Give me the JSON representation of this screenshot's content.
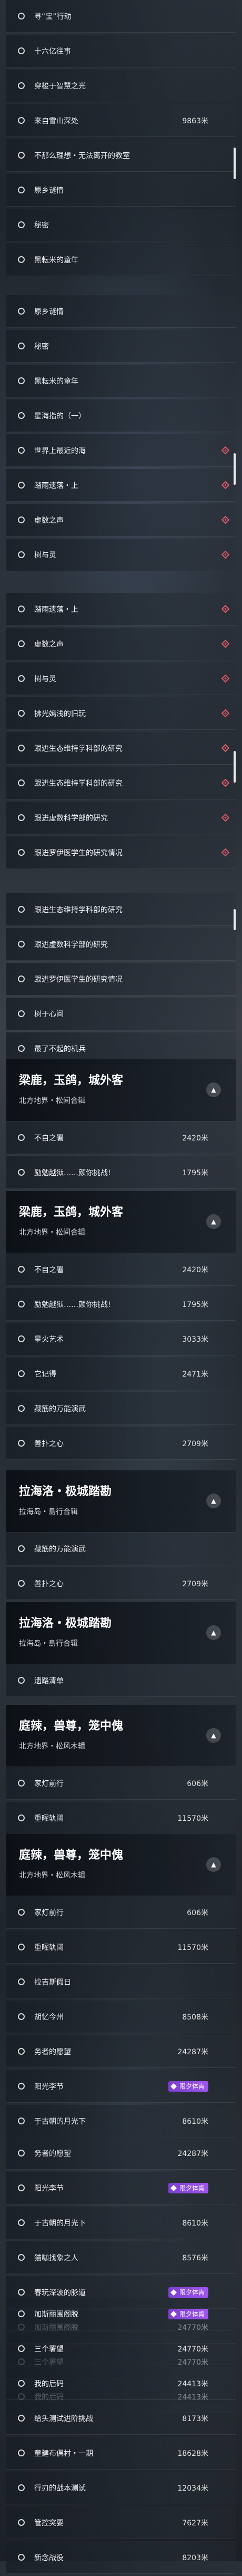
{
  "quests": {
    "g1": [
      {
        "label": "寻“宝”行动"
      },
      {
        "label": "十六亿往事"
      },
      {
        "label": "穿梭于智慧之光"
      },
      {
        "label": "来自雪山深处",
        "dist": "9863米"
      },
      {
        "label": "不那么理想・无法离开的教室"
      },
      {
        "label": "原乡谜情"
      },
      {
        "label": "秘密"
      },
      {
        "label": "黑耘米的童年"
      }
    ],
    "g2": [
      {
        "label": "原乡谜情"
      },
      {
        "label": "秘密"
      },
      {
        "label": "黑耘米的童年"
      },
      {
        "label": "星海指的（一）"
      },
      {
        "label": "世界上最近的海"
      },
      {
        "label": "踏雨遗落・上"
      },
      {
        "label": "虚数之声"
      },
      {
        "label": "树与灵"
      }
    ],
    "g3": [
      {
        "label": "踏雨遗落・上"
      },
      {
        "label": "虚数之声"
      },
      {
        "label": "树与灵"
      },
      {
        "label": "拂光嫣浅的旧玩"
      },
      {
        "label": "跟进生态维持学科部的研究"
      },
      {
        "label": "跟进生态维持学科部的研究"
      },
      {
        "label": "跟进虚数科学部的研究"
      },
      {
        "label": "跟进罗伊医学生的研究情况"
      }
    ],
    "g4": [
      {
        "label": "跟进生态维持学科部的研究"
      },
      {
        "label": "跟进虚数科学部的研究"
      },
      {
        "label": "跟进罗伊医学生的研究情况"
      },
      {
        "label": "树于心间"
      },
      {
        "label": "最了不起的机兵"
      }
    ],
    "sec1": {
      "title": "梁鹿，玉鸽，城外客",
      "sub": "北方地界・松间合辑",
      "btn": "▲"
    },
    "g5": [
      {
        "label": "不自之署",
        "dist": "2420米"
      },
      {
        "label": "励勉越狱……颜你挑战!",
        "dist": "1795米"
      }
    ],
    "sec2": {
      "title": "梁鹿，玉鸽，城外客",
      "sub": "北方地界・松间合辑",
      "btn": "▲"
    },
    "g6": [
      {
        "label": "不自之署",
        "dist": "2420米"
      },
      {
        "label": "励勉越狱……颜你挑战!",
        "dist": "1795米"
      },
      {
        "label": "星火艺术",
        "dist": "3033米"
      },
      {
        "label": "它记得",
        "dist": "2471米"
      },
      {
        "label": "藏筋的万能演武"
      },
      {
        "label": "善扑之心",
        "dist": "2709米"
      }
    ],
    "sec3": {
      "title": "拉海洛・极城踏勘",
      "sub": "拉海岛・島行合辑",
      "btn": "▲"
    },
    "g7": [
      {
        "label": "藏筋的万能演武"
      },
      {
        "label": "善扑之心",
        "dist": "2709米"
      }
    ],
    "sec4": {
      "title": "拉海洛・极城踏勘",
      "sub": "拉海岛・島行合辑",
      "btn": "▲"
    },
    "g8": [
      {
        "label": "遗路清单"
      }
    ],
    "sec5": {
      "title": "庭辣，兽尊，笼中傀",
      "sub": "北方地界・松风木辑",
      "btn": "▲"
    },
    "g9": [
      {
        "label": "家灯前行",
        "dist": "606米"
      },
      {
        "label": "重曜轨阈",
        "dist": "11570米"
      }
    ],
    "sec6": {
      "title": "庭辣，兽尊，笼中傀",
      "sub": "北方地界・松风木辑",
      "btn": "▲"
    },
    "g10": [
      {
        "label": "家灯前行",
        "dist": "606米"
      },
      {
        "label": "重曜轨阈",
        "dist": "11570米"
      },
      {
        "label": "拉吉斯假日"
      },
      {
        "label": "胡忆今州",
        "dist": "8508米"
      },
      {
        "label": "务者的愿望",
        "dist": "24287米"
      },
      {
        "label": "阳光李节",
        "badge": "限夕体肯"
      },
      {
        "label": "于古朝的月光下",
        "dist": "8610米"
      }
    ],
    "g11": [
      {
        "label": "务者的愿望",
        "dist": "24287米"
      },
      {
        "label": "阳光李节",
        "badge": "限夕体肯"
      },
      {
        "label": "于古朝的月光下",
        "dist": "8610米"
      },
      {
        "label": "猫咖找象之人",
        "dist": "8576米"
      },
      {
        "label": "春玩深波的脉道",
        "badge": "限夕体肯"
      },
      {
        "label": "加斯丽围阁脱",
        "dist": "24770米"
      },
      {
        "label": "三个署望",
        "dist": "24770米"
      },
      {
        "label": "我的后码",
        "dist": "24413米"
      }
    ],
    "g12": [
      {
        "label": "加斯丽围阁脱",
        "badge": "限夕体肯"
      },
      {
        "label": "三个署望",
        "dist": "24770米"
      },
      {
        "label": "我的后码",
        "dist": "24413米"
      },
      {
        "label": "给头测试进阶挑战",
        "dist": "8173米"
      },
      {
        "label": "童建布偶村・一期",
        "dist": "18628米"
      },
      {
        "label": "行刃的战本测试",
        "dist": "12034米"
      },
      {
        "label": "管控突要",
        "dist": "7627米"
      },
      {
        "label": "新念战役",
        "dist": "8203米"
      }
    ],
    "sec7": {
      "title": "",
      "sub": "",
      "btn": ""
    }
  },
  "icons": {
    "marker": "quest-circle-icon",
    "tracked": "red-diamond-icon",
    "collapse": "chevron-up-icon"
  },
  "colors": {
    "diamond": "#e05a68",
    "badge": "#8a48e0"
  }
}
